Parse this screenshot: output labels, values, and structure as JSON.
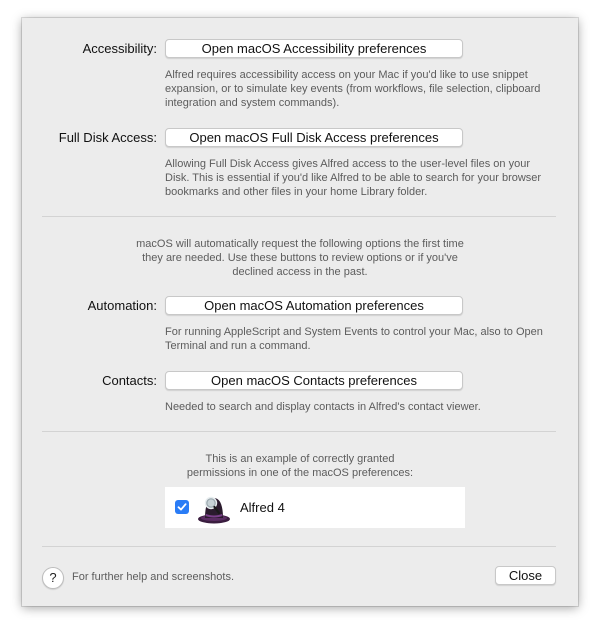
{
  "accessibility": {
    "label": "Accessibility:",
    "button": "Open macOS Accessibility preferences",
    "description": "Alfred requires accessibility access on your Mac if you'd like to use snippet expansion, or to simulate key events (from workflows, file selection, clipboard integration and system commands)."
  },
  "full_disk": {
    "label": "Full Disk Access:",
    "button": "Open macOS Full Disk Access preferences",
    "description": "Allowing Full Disk Access gives Alfred access to the user-level files on your Disk. This is essential if you'd like Alfred to be able to search for your browser bookmarks and other files in your home Library folder."
  },
  "auto_request_note": {
    "line1": "macOS will automatically request the following options the first time",
    "line2": "they are needed. Use these buttons to review options or if you've",
    "line3": "declined access in the past."
  },
  "automation": {
    "label": "Automation:",
    "button": "Open macOS Automation preferences",
    "description": "For running AppleScript and System Events to control your Mac, also to Open Terminal and run a command."
  },
  "contacts": {
    "label": "Contacts:",
    "button": "Open macOS Contacts preferences",
    "description": "Needed to search and display contacts in Alfred's contact viewer."
  },
  "example_note": {
    "line1": "This is an example of correctly granted",
    "line2": "permissions in one of the macOS preferences:"
  },
  "example": {
    "checked": true,
    "app_name": "Alfred 4",
    "checkbox_color": "#2a7cf6"
  },
  "footer": {
    "help_symbol": "?",
    "help_text": "For further help and screenshots.",
    "close_label": "Close"
  }
}
